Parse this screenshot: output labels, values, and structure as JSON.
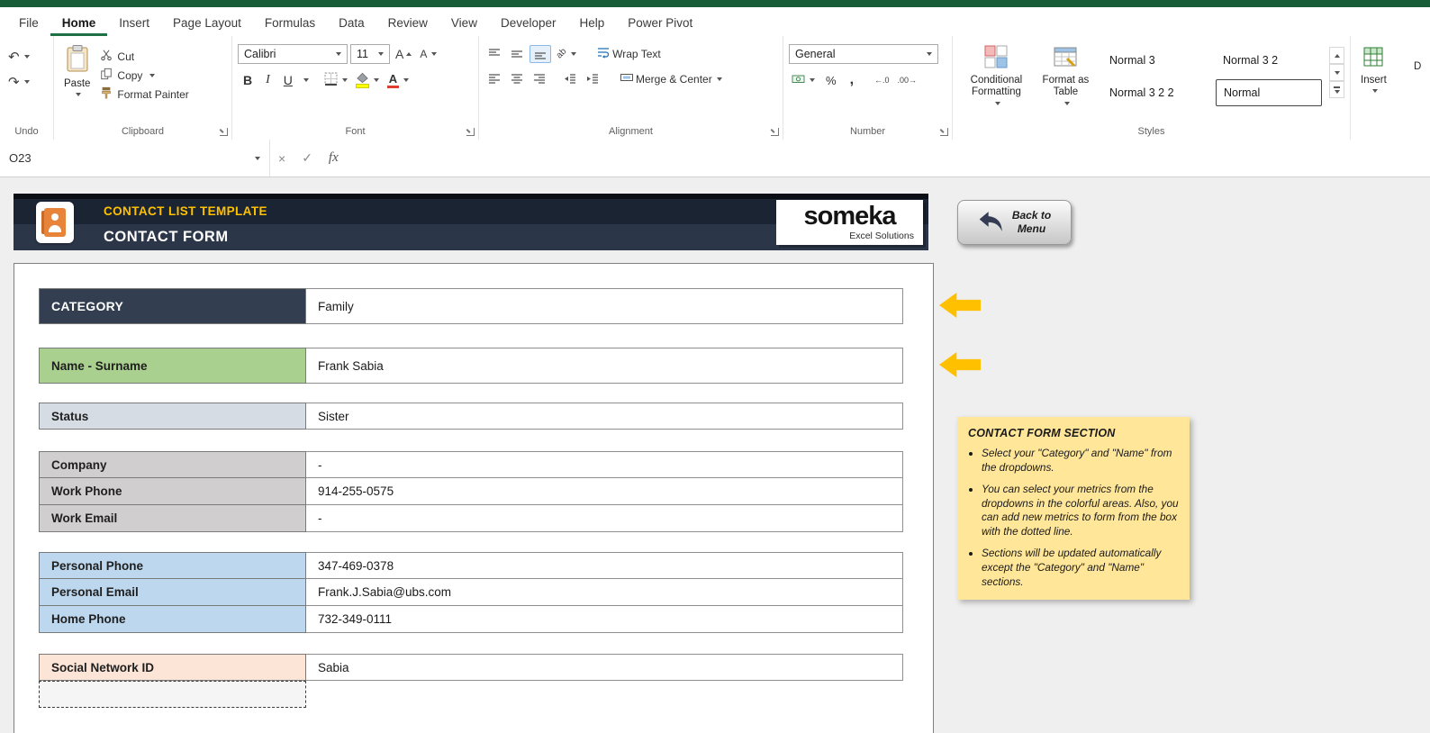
{
  "menu": {
    "tabs": [
      {
        "label": "File"
      },
      {
        "label": "Home"
      },
      {
        "label": "Insert"
      },
      {
        "label": "Page Layout"
      },
      {
        "label": "Formulas"
      },
      {
        "label": "Data"
      },
      {
        "label": "Review"
      },
      {
        "label": "View"
      },
      {
        "label": "Developer"
      },
      {
        "label": "Help"
      },
      {
        "label": "Power Pivot"
      }
    ],
    "active_tab": "Home"
  },
  "ribbon": {
    "undo": {
      "label": "Undo",
      "undo_icon": "↶",
      "redo_icon": "↷"
    },
    "clipboard": {
      "label": "Clipboard",
      "paste": "Paste",
      "cut": "Cut",
      "copy": "Copy",
      "format_painter": "Format Painter"
    },
    "font": {
      "label": "Font",
      "name": "Calibri",
      "size": "11",
      "bold": "B",
      "italic": "I",
      "underline": "U",
      "grow": "A",
      "shrink": "A",
      "color_a": "A",
      "ab": "ab"
    },
    "alignment": {
      "label": "Alignment",
      "wrap_text": "Wrap Text",
      "merge_center": "Merge & Center"
    },
    "number": {
      "label": "Number",
      "format": "General",
      "percent": "%",
      "comma": ",",
      "inc_decimal": "←.0",
      "dec_decimal": ".00→"
    },
    "styles": {
      "label": "Styles",
      "conditional_formatting": "Conditional Formatting",
      "format_as_table": "Format as Table",
      "cells": [
        "Normal 3",
        "Normal 3 2",
        "Normal 3 2 2",
        "Normal"
      ],
      "selected_cell": "Normal"
    },
    "insert": {
      "label": "Insert",
      "partial_next": "D"
    }
  },
  "formula_bar": {
    "name_box": "O23",
    "cancel_icon": "×",
    "enter_icon": "✓",
    "fx_icon": "fx",
    "value": ""
  },
  "sheet": {
    "header": {
      "template_title": "CONTACT LIST TEMPLATE",
      "form_title": "CONTACT FORM",
      "logo_text": "someka",
      "logo_subtext": "Excel Solutions",
      "back_button_line1": "Back to",
      "back_button_line2": "Menu"
    },
    "form": {
      "rows": [
        {
          "label": "CATEGORY",
          "value": "Family"
        },
        {
          "label": "Name - Surname",
          "value": "Frank Sabia"
        },
        {
          "label": "Status",
          "value": "Sister"
        },
        {
          "label": "Company",
          "value": "-"
        },
        {
          "label": "Work Phone",
          "value": "914-255-0575"
        },
        {
          "label": "Work Email",
          "value": "-"
        },
        {
          "label": "Personal Phone",
          "value": "347-469-0378"
        },
        {
          "label": "Personal Email",
          "value": "Frank.J.Sabia@ubs.com"
        },
        {
          "label": "Home Phone",
          "value": "732-349-0111"
        },
        {
          "label": "Social Network ID",
          "value": "Sabia"
        }
      ]
    },
    "note": {
      "title": "CONTACT FORM SECTION",
      "bullets": [
        "Select your \"Category\" and \"Name\" from the dropdowns.",
        "You can select your metrics from the dropdowns in the colorful areas. Also, you can add new metrics to form from the box with the dotted line.",
        "Sections will be updated automatically except the \"Category\" and \"Name\" sections."
      ]
    }
  },
  "colors": {
    "excel_green": "#185C37",
    "header_dark": "#1B2433",
    "header_mid": "#2B3649",
    "category_bg": "#333F50",
    "name_bg": "#A9D08E",
    "status_bg": "#D6DCE4",
    "work_bg": "#D0CECE",
    "personal_bg": "#BDD7EE",
    "social_bg": "#FCE4D6",
    "note_bg": "#FFE699",
    "accent_orange": "#FFC000"
  }
}
